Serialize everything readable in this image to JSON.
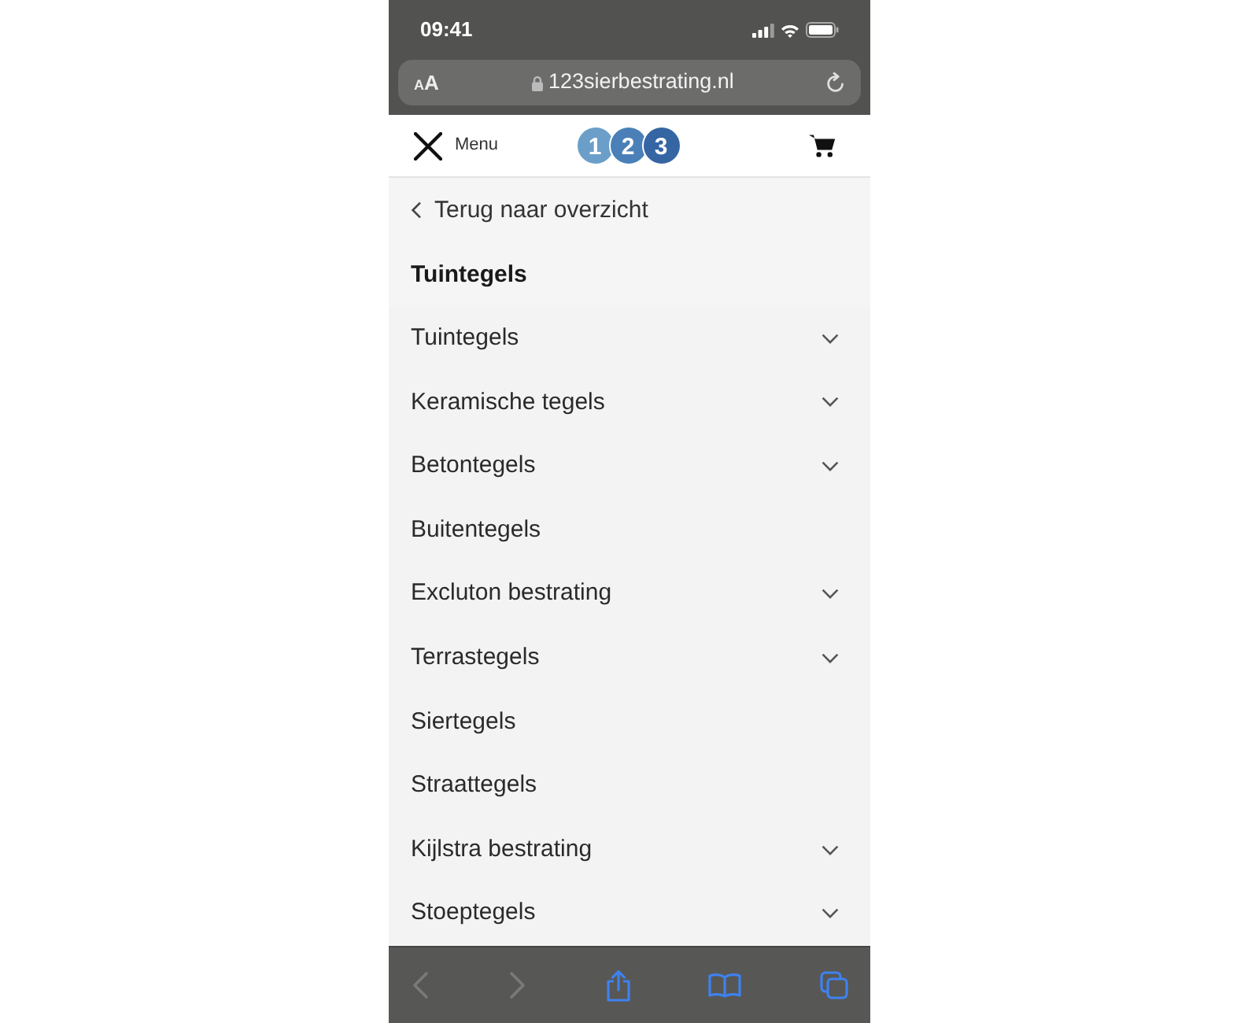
{
  "browser": {
    "time": "09:41",
    "text_size_button": "AA",
    "url": "123sierbestrating.nl"
  },
  "header": {
    "close_label": "Menu",
    "logo_digits": [
      "1",
      "2",
      "3"
    ]
  },
  "menu": {
    "back_link": "Terug naar overzicht",
    "title": "Tuintegels",
    "items": [
      {
        "label": "Tuintegels",
        "has_submenu": true
      },
      {
        "label": "Keramische tegels",
        "has_submenu": true
      },
      {
        "label": "Betontegels",
        "has_submenu": true
      },
      {
        "label": "Buitentegels",
        "has_submenu": false
      },
      {
        "label": "Excluton bestrating",
        "has_submenu": true
      },
      {
        "label": "Terrastegels",
        "has_submenu": true
      },
      {
        "label": "Siertegels",
        "has_submenu": false
      },
      {
        "label": "Straattegels",
        "has_submenu": false
      },
      {
        "label": "Kijlstra bestrating",
        "has_submenu": true
      },
      {
        "label": "Stoeptegels",
        "has_submenu": true
      }
    ]
  },
  "toolbar": {
    "back_disabled": true,
    "forward_disabled": true
  }
}
